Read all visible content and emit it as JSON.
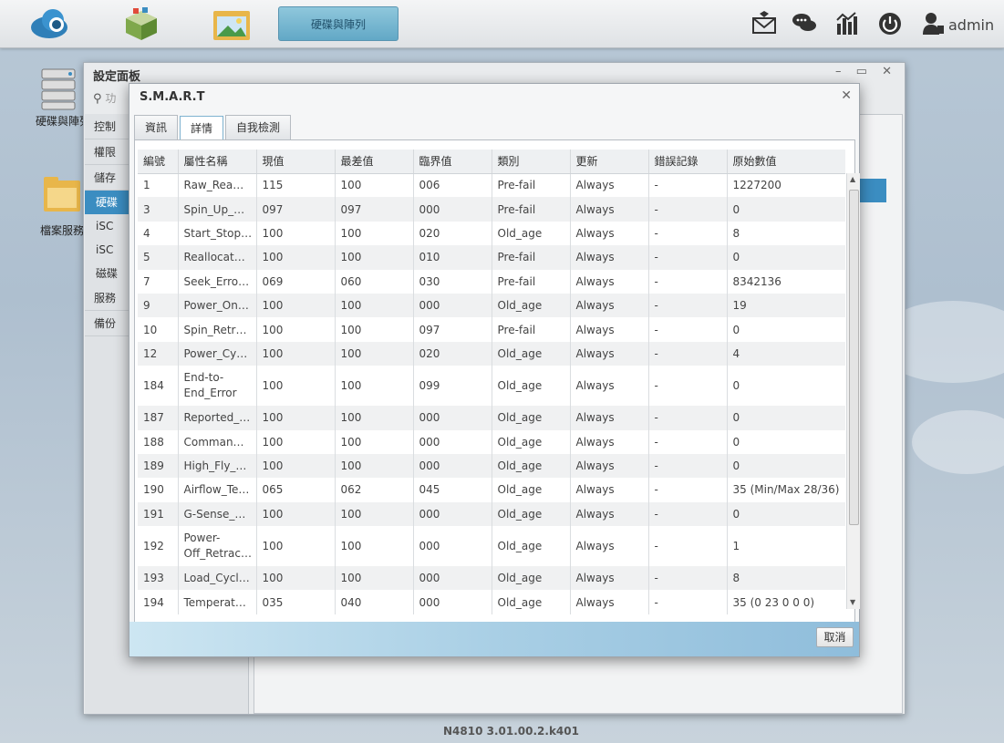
{
  "topbar": {
    "active_app": "硬碟與陣列",
    "user": "admin",
    "icons": [
      "cloud-icon",
      "box-icon",
      "folder-image-icon",
      "mail-icon",
      "chat-icon",
      "chart-icon",
      "power-icon",
      "user-icon"
    ]
  },
  "desktop": {
    "icon1_label": "硬碟與陣列",
    "icon2_label": "檔案服務"
  },
  "panel": {
    "title": "設定面板",
    "search_placeholder": "功",
    "nav": [
      "控制",
      "權限",
      "儲存",
      "服務",
      "備份"
    ],
    "sub": [
      "硬碟",
      "iSC",
      "iSC",
      "磁碟"
    ]
  },
  "footer": {
    "version": "N4810   3.01.00.2.k401"
  },
  "modal": {
    "title": "S.M.A.R.T",
    "tabs": [
      "資訊",
      "詳情",
      "自我檢測"
    ],
    "active_tab": 1,
    "cancel": "取消",
    "columns": [
      "編號",
      "屬性名稱",
      "現值",
      "最差值",
      "臨界值",
      "類別",
      "更新",
      "錯誤記錄",
      "原始數值"
    ],
    "rows": [
      {
        "id": "1",
        "name": "Raw_Rea…",
        "value": "115",
        "worst": "100",
        "thresh": "006",
        "type": "Pre-fail",
        "updated": "Always",
        "failed": "-",
        "raw": "1227200"
      },
      {
        "id": "3",
        "name": "Spin_Up_…",
        "value": "097",
        "worst": "097",
        "thresh": "000",
        "type": "Pre-fail",
        "updated": "Always",
        "failed": "-",
        "raw": "0"
      },
      {
        "id": "4",
        "name": "Start_Stop…",
        "value": "100",
        "worst": "100",
        "thresh": "020",
        "type": "Old_age",
        "updated": "Always",
        "failed": "-",
        "raw": "8"
      },
      {
        "id": "5",
        "name": "Reallocat…",
        "value": "100",
        "worst": "100",
        "thresh": "010",
        "type": "Pre-fail",
        "updated": "Always",
        "failed": "-",
        "raw": "0"
      },
      {
        "id": "7",
        "name": "Seek_Erro…",
        "value": "069",
        "worst": "060",
        "thresh": "030",
        "type": "Pre-fail",
        "updated": "Always",
        "failed": "-",
        "raw": "8342136"
      },
      {
        "id": "9",
        "name": "Power_On…",
        "value": "100",
        "worst": "100",
        "thresh": "000",
        "type": "Old_age",
        "updated": "Always",
        "failed": "-",
        "raw": "19"
      },
      {
        "id": "10",
        "name": "Spin_Retr…",
        "value": "100",
        "worst": "100",
        "thresh": "097",
        "type": "Pre-fail",
        "updated": "Always",
        "failed": "-",
        "raw": "0"
      },
      {
        "id": "12",
        "name": "Power_Cy…",
        "value": "100",
        "worst": "100",
        "thresh": "020",
        "type": "Old_age",
        "updated": "Always",
        "failed": "-",
        "raw": "4"
      },
      {
        "id": "184",
        "name": "End-to-End_Error",
        "value": "100",
        "worst": "100",
        "thresh": "099",
        "type": "Old_age",
        "updated": "Always",
        "failed": "-",
        "raw": "0"
      },
      {
        "id": "187",
        "name": "Reported_…",
        "value": "100",
        "worst": "100",
        "thresh": "000",
        "type": "Old_age",
        "updated": "Always",
        "failed": "-",
        "raw": "0"
      },
      {
        "id": "188",
        "name": "Comman…",
        "value": "100",
        "worst": "100",
        "thresh": "000",
        "type": "Old_age",
        "updated": "Always",
        "failed": "-",
        "raw": "0"
      },
      {
        "id": "189",
        "name": "High_Fly_…",
        "value": "100",
        "worst": "100",
        "thresh": "000",
        "type": "Old_age",
        "updated": "Always",
        "failed": "-",
        "raw": "0"
      },
      {
        "id": "190",
        "name": "Airflow_Te…",
        "value": "065",
        "worst": "062",
        "thresh": "045",
        "type": "Old_age",
        "updated": "Always",
        "failed": "-",
        "raw": "35 (Min/Max 28/36)"
      },
      {
        "id": "191",
        "name": "G-Sense_…",
        "value": "100",
        "worst": "100",
        "thresh": "000",
        "type": "Old_age",
        "updated": "Always",
        "failed": "-",
        "raw": "0"
      },
      {
        "id": "192",
        "name": "Power-Off_Retrac…",
        "value": "100",
        "worst": "100",
        "thresh": "000",
        "type": "Old_age",
        "updated": "Always",
        "failed": "-",
        "raw": "1"
      },
      {
        "id": "193",
        "name": "Load_Cycl…",
        "value": "100",
        "worst": "100",
        "thresh": "000",
        "type": "Old_age",
        "updated": "Always",
        "failed": "-",
        "raw": "8"
      },
      {
        "id": "194",
        "name": "Temperat…",
        "value": "035",
        "worst": "040",
        "thresh": "000",
        "type": "Old_age",
        "updated": "Always",
        "failed": "-",
        "raw": "35 (0 23 0 0 0)"
      }
    ]
  }
}
